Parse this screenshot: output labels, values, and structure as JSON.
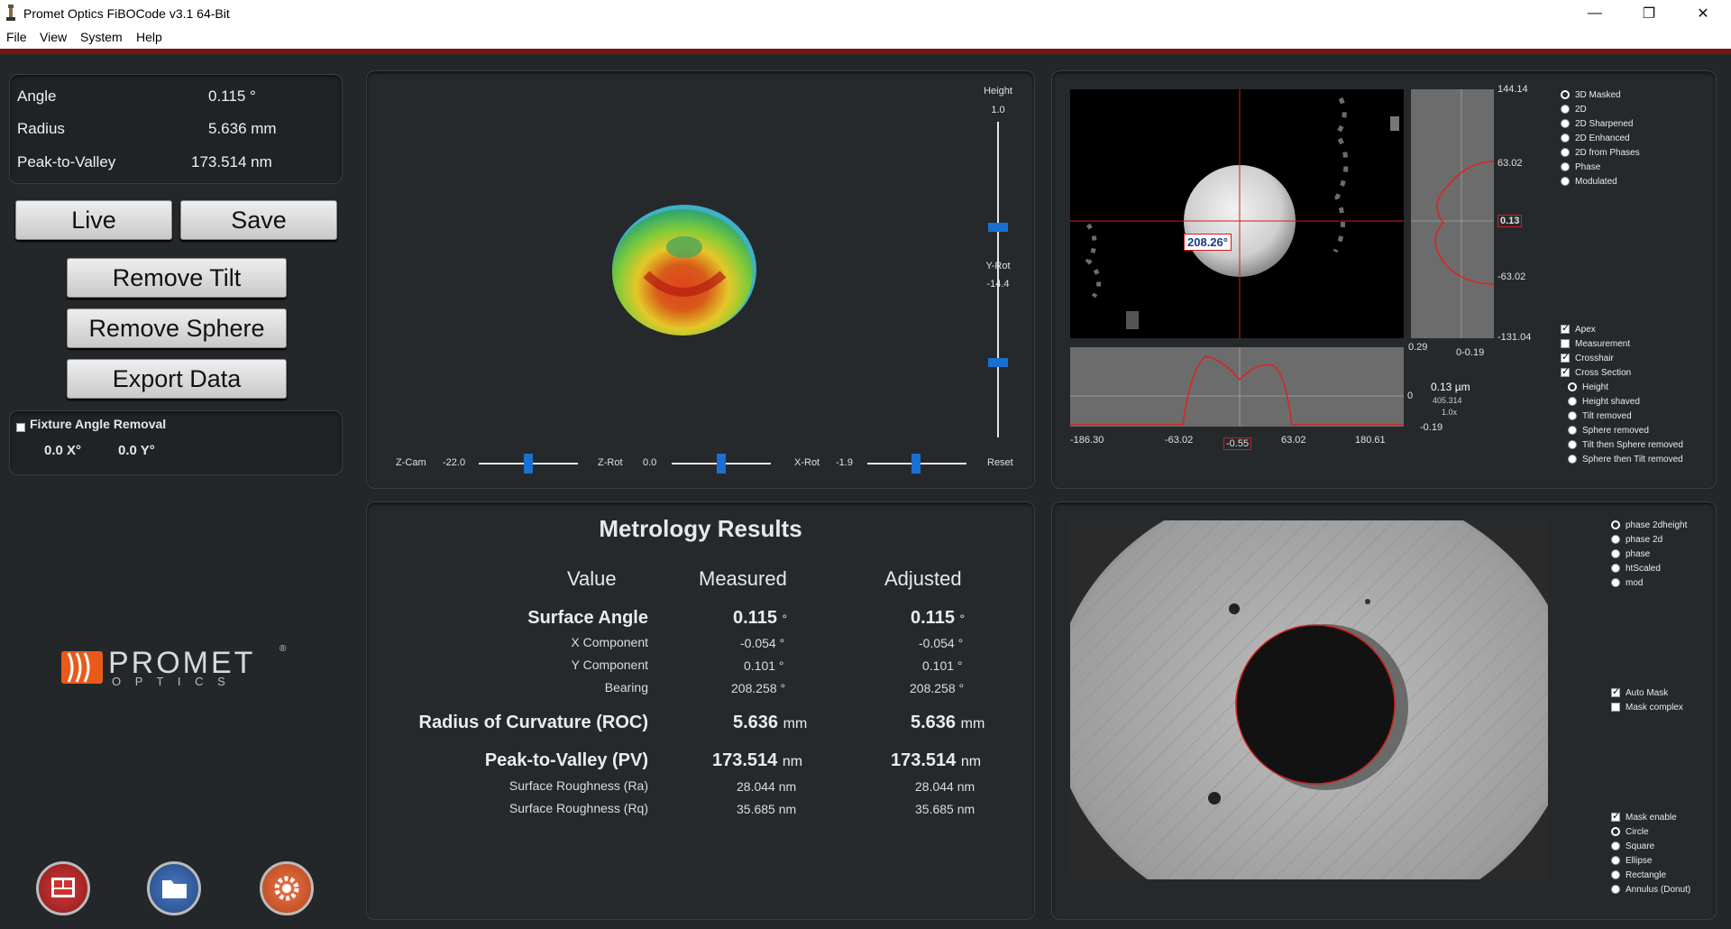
{
  "window": {
    "title": "Promet Optics FiBOCode v3.1 64-Bit",
    "minimize": "—",
    "restore": "❐",
    "close": "✕"
  },
  "menu": [
    "File",
    "View",
    "System",
    "Help"
  ],
  "summary": {
    "angle_label": "Angle",
    "angle_value": "0.115 °",
    "radius_label": "Radius",
    "radius_value": "5.636 mm",
    "pv_label": "Peak-to-Valley",
    "pv_value": "173.514 nm"
  },
  "buttons": {
    "live": "Live",
    "save": "Save",
    "remove_tilt": "Remove Tilt",
    "remove_sphere": "Remove Sphere",
    "export": "Export Data"
  },
  "fixture": {
    "label": "Fixture Angle Removal",
    "x": "0.0 X°",
    "y": "0.0 Y°"
  },
  "logo": {
    "name": "PROMET",
    "sub": "O P T I C S",
    "reg": "®"
  },
  "view3d": {
    "height_label": "Height",
    "height_value": "1.0",
    "yrot_label": "Y-Rot",
    "yrot_value": "-14.4",
    "zcam_label": "Z-Cam",
    "zcam_value": "-22.0",
    "zrot_label": "Z-Rot",
    "zrot_value": "0.0",
    "xrot_label": "X-Rot",
    "xrot_value": "-1.9",
    "reset": "Reset"
  },
  "analysis": {
    "angle_tag": "208.26°",
    "vprofile_ticks": [
      "144.14",
      "63.02",
      "0.13",
      "-63.02",
      "-131.04"
    ],
    "vprofile_bottom": [
      "0.29",
      "0-0.19"
    ],
    "hprofile_ticks": [
      "-186.30",
      "-63.02",
      "-0.55",
      "63.02",
      "180.61"
    ],
    "hprofile_y": [
      "0",
      "-0.19"
    ],
    "readout_main": "0.13 µm",
    "readout_sub1": "405.314",
    "readout_sub2": "1.0x",
    "display_modes": [
      "3D Masked",
      "2D",
      "2D Sharpened",
      "2D Enhanced",
      "2D from Phases",
      "Phase",
      "Modulated"
    ],
    "overlays": [
      "Apex",
      "Measurement",
      "Crosshair",
      "Cross Section"
    ],
    "section_modes": [
      "Height",
      "Height shaved",
      "Tilt removed",
      "Sphere removed",
      "Tilt then Sphere removed",
      "Sphere then Tilt removed"
    ]
  },
  "results": {
    "title": "Metrology Results",
    "col_value": "Value",
    "col_measured": "Measured",
    "col_adjusted": "Adjusted",
    "surface_angle": "Surface Angle",
    "sa_m": "0.115",
    "sa_a": "0.115",
    "deg": "°",
    "xcomp": "X Component",
    "x_m": "-0.054 °",
    "x_a": "-0.054 °",
    "ycomp": "Y Component",
    "y_m": "0.101 °",
    "y_a": "0.101 °",
    "bearing": "Bearing",
    "b_m": "208.258 °",
    "b_a": "208.258 °",
    "roc": "Radius of Curvature (ROC)",
    "roc_m": "5.636",
    "roc_a": "5.636",
    "mm": "mm",
    "pv": "Peak-to-Valley (PV)",
    "pv_m": "173.514",
    "pv_a": "173.514",
    "nm": "nm",
    "ra": "Surface Roughness (Ra)",
    "ra_m": "28.044 nm",
    "ra_a": "28.044 nm",
    "rq": "Surface Roughness (Rq)",
    "rq_m": "35.685 nm",
    "rq_a": "35.685 nm"
  },
  "camera": {
    "modes": [
      "phase 2dheight",
      "phase 2d",
      "phase",
      "htScaled",
      "mod"
    ],
    "mask_opts": [
      "Auto Mask",
      "Mask complex"
    ],
    "shape_header": "Mask enable",
    "shapes": [
      "Circle",
      "Square",
      "Ellipse",
      "Rectangle",
      "Annulus (Donut)"
    ]
  }
}
